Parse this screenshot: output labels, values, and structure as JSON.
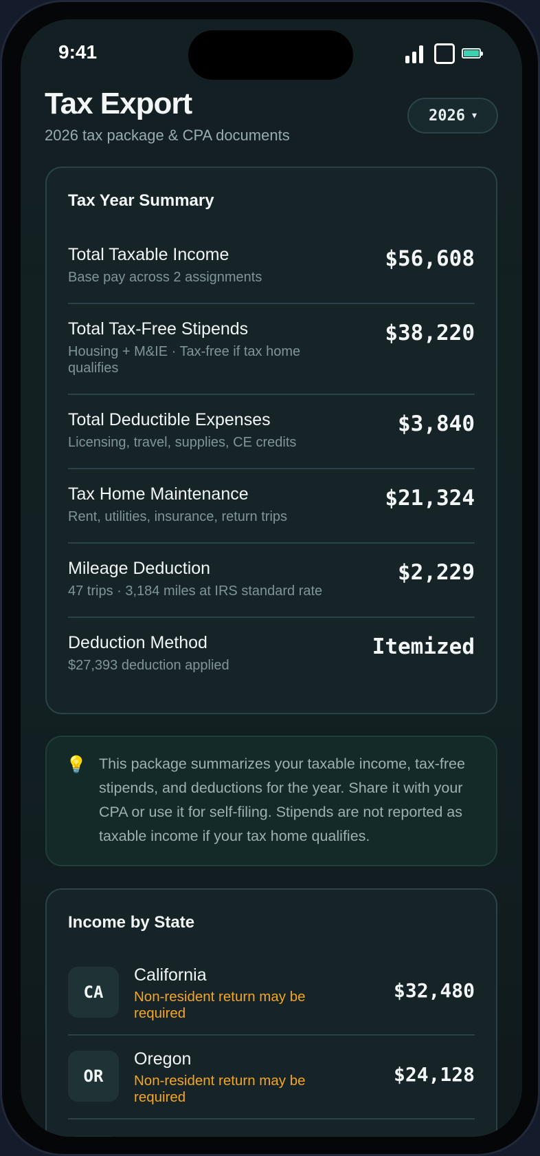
{
  "status_bar": {
    "time": "9:41"
  },
  "header": {
    "title": "Tax Export",
    "subtitle": "2026 tax package & CPA documents",
    "year_selector": {
      "value": "2026",
      "caret": "▾"
    }
  },
  "summary": {
    "title": "Tax Year Summary",
    "rows": [
      {
        "label": "Total Taxable Income",
        "sub": "Base pay across 2 assignments",
        "value": "$56,608"
      },
      {
        "label": "Total Tax-Free Stipends",
        "sub": "Housing + M&IE · Tax-free if tax home qualifies",
        "value": "$38,220"
      },
      {
        "label": "Total Deductible Expenses",
        "sub": "Licensing, travel, supplies, CE credits",
        "value": "$3,840"
      },
      {
        "label": "Tax Home Maintenance",
        "sub": "Rent, utilities, insurance, return trips",
        "value": "$21,324"
      },
      {
        "label": "Mileage Deduction",
        "sub": "47 trips · 3,184 miles at IRS standard rate",
        "value": "$2,229"
      },
      {
        "label": "Deduction Method",
        "sub": "$27,393 deduction applied",
        "value": "Itemized"
      }
    ]
  },
  "info": {
    "icon": "lightbulb-icon",
    "icon_glyph": "💡",
    "text": "This package summarizes your taxable income, tax-free stipends, and deductions for the year. Share it with your CPA or use it for self-filing. Stipends are not reported as taxable income if your tax home qualifies."
  },
  "states": {
    "title": "Income by State",
    "items": [
      {
        "code": "CA",
        "name": "California",
        "note": "Non-resident return may be required",
        "value": "$32,480"
      },
      {
        "code": "OR",
        "name": "Oregon",
        "note": "Non-resident return may be required",
        "value": "$24,128"
      }
    ]
  },
  "colors": {
    "accent": "#3fd0b0",
    "warning": "#f5a524",
    "card_bg": "#172427",
    "card_border": "#2a4347"
  }
}
